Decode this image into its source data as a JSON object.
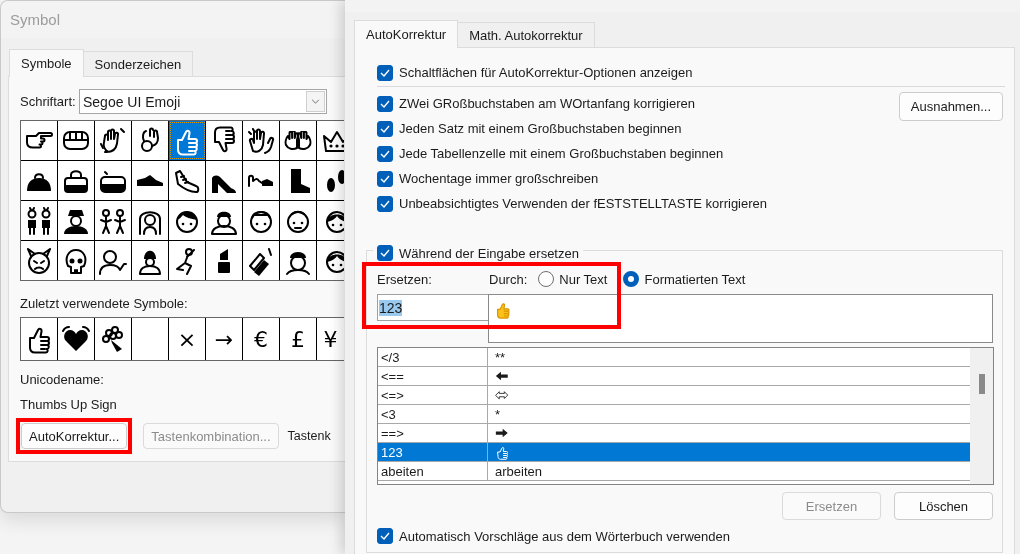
{
  "symbol_dialog": {
    "title": "Symbol",
    "tabs": [
      {
        "label": "Symbole",
        "selected": true
      },
      {
        "label": "Sonderzeichen",
        "selected": false
      }
    ],
    "font_label": "Schriftart:",
    "font_value": "Segoe UI Emoji",
    "symbol_grid": [
      [
        {
          "kind": "pointing-hand",
          "selected": false
        },
        {
          "kind": "fist",
          "selected": false
        },
        {
          "kind": "waving-hand",
          "selected": false
        },
        {
          "kind": "ok-hand",
          "selected": false
        },
        {
          "kind": "thumbs-up",
          "selected": true
        },
        {
          "kind": "thumbs-down",
          "selected": false
        },
        {
          "kind": "clapping-hands",
          "selected": false
        },
        {
          "kind": "open-hands",
          "selected": false
        },
        {
          "kind": "crown",
          "selected": false
        }
      ],
      [
        {
          "kind": "purse",
          "selected": false
        },
        {
          "kind": "handbag",
          "selected": false
        },
        {
          "kind": "pouch",
          "selected": false
        },
        {
          "kind": "shoe",
          "selected": false
        },
        {
          "kind": "sneaker",
          "selected": false
        },
        {
          "kind": "high-heel",
          "selected": false
        },
        {
          "kind": "sandal",
          "selected": false
        },
        {
          "kind": "boot",
          "selected": false
        },
        {
          "kind": "footprints",
          "selected": false
        }
      ],
      [
        {
          "kind": "two-women",
          "selected": false
        },
        {
          "kind": "police-officer",
          "selected": false
        },
        {
          "kind": "two-men",
          "selected": false
        },
        {
          "kind": "bride",
          "selected": false
        },
        {
          "kind": "boy-face",
          "selected": false
        },
        {
          "kind": "man-in-cap",
          "selected": false
        },
        {
          "kind": "man-face",
          "selected": false
        },
        {
          "kind": "old-man-face",
          "selected": false
        },
        {
          "kind": "woman-face",
          "selected": false
        }
      ],
      [
        {
          "kind": "devil-face",
          "selected": false
        },
        {
          "kind": "skull",
          "selected": false
        },
        {
          "kind": "person-raising-hand",
          "selected": false
        },
        {
          "kind": "guard",
          "selected": false
        },
        {
          "kind": "dancer",
          "selected": false
        },
        {
          "kind": "lipstick",
          "selected": false
        },
        {
          "kind": "nail-polish",
          "selected": false
        },
        {
          "kind": "person-face",
          "selected": false
        },
        {
          "kind": "woman-face",
          "selected": false
        }
      ]
    ],
    "recent_label": "Zuletzt verwendete Symbole:",
    "recent_symbols": [
      {
        "kind": "thumbs-up"
      },
      {
        "kind": "beating-heart"
      },
      {
        "kind": "bouquet"
      },
      {
        "kind": "blank"
      },
      {
        "kind": "char",
        "char": "×"
      },
      {
        "kind": "char",
        "char": "→"
      },
      {
        "kind": "char",
        "char": "€"
      },
      {
        "kind": "char",
        "char": "£"
      },
      {
        "kind": "char",
        "char": "¥"
      }
    ],
    "unicode_label": "Unicodename:",
    "unicode_name": "Thumbs Up Sign",
    "buttons": [
      {
        "label": "AutoKorrektur...",
        "disabled": false,
        "highlighted": true
      },
      {
        "label": "Tastenkombination...",
        "disabled": true,
        "highlighted": false
      }
    ],
    "shortcut_label": "Tastenk"
  },
  "autocorrect_dialog": {
    "tabs": [
      {
        "label": "AutoKorrektur",
        "selected": true
      },
      {
        "label": "Math. Autokorrektur",
        "selected": false
      }
    ],
    "show_buttons_option": {
      "label": "Schaltflächen für AutoKorrektur-Optionen anzeigen",
      "checked": true
    },
    "options": [
      {
        "label": "ZWei GRoßbuchstaben am WOrtanfang korrigieren",
        "checked": true
      },
      {
        "label": "Jeden Satz mit einem Großbuchstaben beginnen",
        "checked": true
      },
      {
        "label": "Jede Tabellenzelle mit einem Großbuchstaben beginnen",
        "checked": true
      },
      {
        "label": "Wochentage immer großschreiben",
        "checked": true
      },
      {
        "label": "Unbeabsichtigtes Verwenden der fESTSTELLTASTE korrigieren",
        "checked": true
      }
    ],
    "exceptions_button": "Ausnahmen...",
    "replace_while_typing": {
      "label": "Während der Eingabe ersetzen",
      "checked": true
    },
    "replace_highlighted": true,
    "replace_label": "Ersetzen:",
    "with_label": "Durch:",
    "format_options": [
      {
        "label": "Nur Text",
        "selected": false
      },
      {
        "label": "Formatierten Text",
        "selected": true
      }
    ],
    "replace_value": "123",
    "replace_text_selected": true,
    "with_value": {
      "kind": "thumbs-up"
    },
    "entries": [
      {
        "replace": "</3",
        "with": "**",
        "kind": "text",
        "selected": false
      },
      {
        "replace": "<==",
        "kind": "left-arrow",
        "selected": false
      },
      {
        "replace": "<=>",
        "kind": "double-arrow",
        "selected": false
      },
      {
        "replace": "<3",
        "with": "*",
        "kind": "text",
        "selected": false
      },
      {
        "replace": "==>",
        "kind": "right-arrow",
        "selected": false
      },
      {
        "replace": "123",
        "kind": "thumbs-up",
        "selected": true
      },
      {
        "replace": "abeiten",
        "with": "arbeiten",
        "kind": "text",
        "selected": false
      }
    ],
    "buttons": [
      {
        "label": "Ersetzen",
        "disabled": true
      },
      {
        "label": "Löschen",
        "disabled": false
      }
    ],
    "suggestions_option": {
      "label": "Automatisch Vorschläge aus dem Wörterbuch verwenden",
      "checked": true
    }
  }
}
